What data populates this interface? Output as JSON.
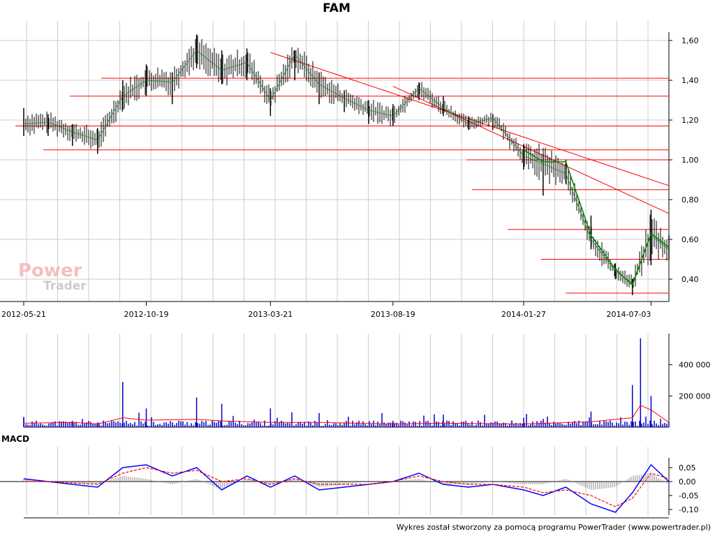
{
  "title": "FAM",
  "macd_label": "MACD",
  "footer": "Wykres został stworzony za pomocą programu PowerTrader (www.powertrader.pl)",
  "watermark": {
    "line1": "Power",
    "line2": "Trader"
  },
  "colors": {
    "candle": "#000000",
    "trend": "#ff0000",
    "ma": "#008000",
    "volume": "#0000cc",
    "volume_avg": "#ff0000",
    "macd": "#0000ff",
    "signal": "#ff0000",
    "hist": "#888888",
    "grid": "#cccccc"
  },
  "chart_data": [
    {
      "type": "line",
      "name": "price",
      "title": "FAM",
      "x_ticks": [
        "2012-05-21",
        "2012-10-19",
        "2013-03-21",
        "2013-08-19",
        "2014-01-27",
        "2014-07-03"
      ],
      "y_ticks": [
        "0,40",
        "0,60",
        "0,80",
        "1,00",
        "1,20",
        "1,40",
        "1,60"
      ],
      "ylim": [
        0.32,
        1.65
      ],
      "grid": true,
      "x": [
        "2012-05-21",
        "2012-06-20",
        "2012-07-20",
        "2012-08-20",
        "2012-09-20",
        "2012-10-19",
        "2012-11-20",
        "2012-12-20",
        "2013-01-20",
        "2013-02-20",
        "2013-03-21",
        "2013-04-20",
        "2013-05-20",
        "2013-06-20",
        "2013-07-20",
        "2013-08-19",
        "2013-09-20",
        "2013-10-20",
        "2013-11-20",
        "2013-12-20",
        "2014-01-27",
        "2014-02-20",
        "2014-03-20",
        "2014-04-20",
        "2014-05-20",
        "2014-06-10",
        "2014-07-03",
        "2014-07-25"
      ],
      "close": [
        1.18,
        1.19,
        1.14,
        1.1,
        1.32,
        1.4,
        1.39,
        1.55,
        1.45,
        1.49,
        1.3,
        1.53,
        1.38,
        1.31,
        1.25,
        1.22,
        1.36,
        1.26,
        1.18,
        1.21,
        1.02,
        0.98,
        0.93,
        0.6,
        0.44,
        0.38,
        0.62,
        0.55
      ],
      "high": [
        1.26,
        1.23,
        1.18,
        1.16,
        1.4,
        1.48,
        1.44,
        1.63,
        1.55,
        1.56,
        1.36,
        1.55,
        1.44,
        1.35,
        1.3,
        1.28,
        1.39,
        1.32,
        1.22,
        1.23,
        1.08,
        1.03,
        1.0,
        0.72,
        0.48,
        0.4,
        0.75,
        0.62
      ],
      "low": [
        1.12,
        1.12,
        1.07,
        1.03,
        1.25,
        1.32,
        1.28,
        1.46,
        1.38,
        1.4,
        1.22,
        1.4,
        1.28,
        1.24,
        1.18,
        1.17,
        1.3,
        1.22,
        1.15,
        1.15,
        0.95,
        0.82,
        0.88,
        0.55,
        0.4,
        0.32,
        0.47,
        0.5
      ],
      "ma": [
        null,
        null,
        null,
        null,
        null,
        null,
        null,
        null,
        null,
        null,
        null,
        null,
        null,
        null,
        null,
        null,
        null,
        null,
        null,
        null,
        1.05,
        0.99,
        0.99,
        0.62,
        0.45,
        0.37,
        0.63,
        0.56
      ],
      "horizontal_levels": [
        1.41,
        1.32,
        1.17,
        1.05,
        1.0,
        0.85,
        0.65,
        0.5,
        0.33
      ],
      "trendlines": [
        {
          "from": [
            "2013-03-21",
            1.54
          ],
          "to": [
            "2014-07-25",
            0.87
          ]
        },
        {
          "from": [
            "2013-08-19",
            1.37
          ],
          "to": [
            "2014-07-25",
            0.73
          ]
        }
      ]
    },
    {
      "type": "bar",
      "name": "volume",
      "y_ticks": [
        "200 000",
        "400 000"
      ],
      "ylim": [
        0,
        600000
      ],
      "x": [
        "2012-05-21",
        "2012-07-20",
        "2012-08-20",
        "2012-09-20",
        "2012-10-19",
        "2012-12-20",
        "2013-01-20",
        "2013-03-21",
        "2013-05-20",
        "2013-08-19",
        "2013-10-20",
        "2014-01-27",
        "2014-04-20",
        "2014-06-10",
        "2014-06-20",
        "2014-07-03",
        "2014-07-25"
      ],
      "values": [
        60000,
        40000,
        30000,
        290000,
        120000,
        190000,
        150000,
        120000,
        90000,
        40000,
        80000,
        60000,
        100000,
        270000,
        570000,
        200000,
        30000
      ],
      "avg": [
        25000,
        30000,
        20000,
        60000,
        45000,
        50000,
        40000,
        30000,
        30000,
        20000,
        25000,
        20000,
        35000,
        60000,
        140000,
        110000,
        30000
      ]
    },
    {
      "type": "line",
      "name": "MACD",
      "title": "MACD",
      "y_ticks": [
        "0,05",
        "0,00",
        "-0,05",
        "-0,10"
      ],
      "ylim": [
        -0.12,
        0.08
      ],
      "x": [
        "2012-05-21",
        "2012-06-20",
        "2012-07-20",
        "2012-08-20",
        "2012-09-20",
        "2012-10-19",
        "2012-11-20",
        "2012-12-20",
        "2013-01-20",
        "2013-02-20",
        "2013-03-21",
        "2013-04-20",
        "2013-05-20",
        "2013-06-20",
        "2013-07-20",
        "2013-08-19",
        "2013-09-20",
        "2013-10-20",
        "2013-11-20",
        "2013-12-20",
        "2014-01-27",
        "2014-02-20",
        "2014-03-20",
        "2014-04-20",
        "2014-05-20",
        "2014-06-10",
        "2014-07-03",
        "2014-07-25"
      ],
      "macd": [
        0.01,
        0.0,
        -0.01,
        -0.02,
        0.05,
        0.06,
        0.02,
        0.05,
        -0.03,
        0.02,
        -0.02,
        0.02,
        -0.03,
        -0.02,
        -0.01,
        0.0,
        0.03,
        -0.01,
        -0.02,
        -0.01,
        -0.03,
        -0.05,
        -0.02,
        -0.08,
        -0.11,
        -0.04,
        0.06,
        0.0
      ],
      "signal": [
        0.0,
        0.0,
        -0.005,
        -0.01,
        0.03,
        0.05,
        0.03,
        0.04,
        0.0,
        0.01,
        -0.01,
        0.01,
        -0.01,
        -0.01,
        -0.01,
        0.0,
        0.02,
        0.0,
        -0.01,
        -0.01,
        -0.02,
        -0.04,
        -0.03,
        -0.05,
        -0.09,
        -0.06,
        0.03,
        0.01
      ]
    }
  ]
}
